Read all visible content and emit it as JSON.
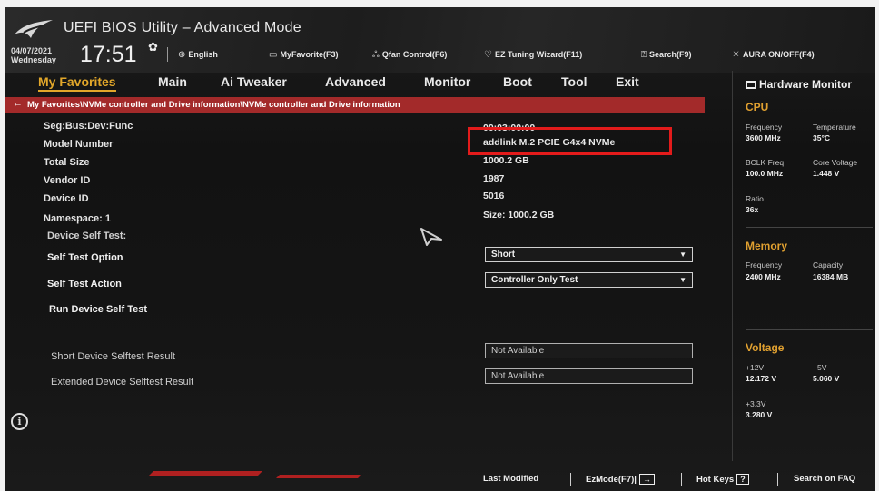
{
  "header": {
    "title": "UEFI BIOS Utility – Advanced Mode",
    "date_line1": "04/07/2021",
    "date_line2": "Wednesday",
    "time": "17:51",
    "language": "English",
    "myfavorite": "MyFavorite(F3)",
    "qfan": "Qfan Control(F6)",
    "eztuning": "EZ Tuning Wizard(F11)",
    "search": "Search(F9)",
    "aura": "AURA ON/OFF(F4)"
  },
  "menu": {
    "tabs": [
      "My Favorites",
      "Main",
      "Ai Tweaker",
      "Advanced",
      "Monitor",
      "Boot",
      "Tool",
      "Exit"
    ],
    "active": "My Favorites"
  },
  "breadcrumb": "My Favorites\\NVMe controller and Drive information\\NVMe controller and Drive information",
  "fields": {
    "seg_label": "Seg:Bus:Dev:Func",
    "seg_value": "00:03:00:00",
    "model_label": "Model Number",
    "model_value": "addlink M.2 PCIE G4x4 NVMe",
    "size_label": "Total Size",
    "size_value": "1000.2 GB",
    "vendor_label": "Vendor ID",
    "vendor_value": "1987",
    "device_label": "Device ID",
    "device_value": "5016",
    "namespace_label": "Namespace: 1",
    "namespace_value": "Size: 1000.2 GB",
    "selftest_label": "Device Self Test:",
    "option_label": "Self Test Option",
    "option_value": "Short",
    "action_label": "Self Test Action",
    "action_value": "Controller Only Test",
    "run_label": "Run Device Self Test",
    "short_result_label": "Short Device Selftest Result",
    "short_result_value": "Not Available",
    "ext_result_label": "Extended Device Selftest Result",
    "ext_result_value": "Not Available"
  },
  "hwmon": {
    "title": "Hardware Monitor",
    "cpu": {
      "head": "CPU",
      "freq_k": "Frequency",
      "freq_v": "3600 MHz",
      "temp_k": "Temperature",
      "temp_v": "35°C",
      "bclk_k": "BCLK Freq",
      "bclk_v": "100.0 MHz",
      "cv_k": "Core Voltage",
      "cv_v": "1.448 V",
      "ratio_k": "Ratio",
      "ratio_v": "36x"
    },
    "memory": {
      "head": "Memory",
      "freq_k": "Frequency",
      "freq_v": "2400 MHz",
      "cap_k": "Capacity",
      "cap_v": "16384 MB"
    },
    "voltage": {
      "head": "Voltage",
      "v12_k": "+12V",
      "v12_v": "12.172 V",
      "v5_k": "+5V",
      "v5_v": "5.060 V",
      "v33_k": "+3.3V",
      "v33_v": "3.280 V"
    }
  },
  "footer": {
    "last_modified": "Last Modified",
    "ezmode": "EzMode(F7)|",
    "ezmode_icon": "→",
    "hotkeys": "Hot Keys",
    "hotkeys_icon": "?",
    "faq": "Search on FAQ"
  },
  "colors": {
    "accent": "#e2a72a",
    "breadcrumb_bar": "#a32a2a",
    "highlight_box": "#e31b1b"
  }
}
